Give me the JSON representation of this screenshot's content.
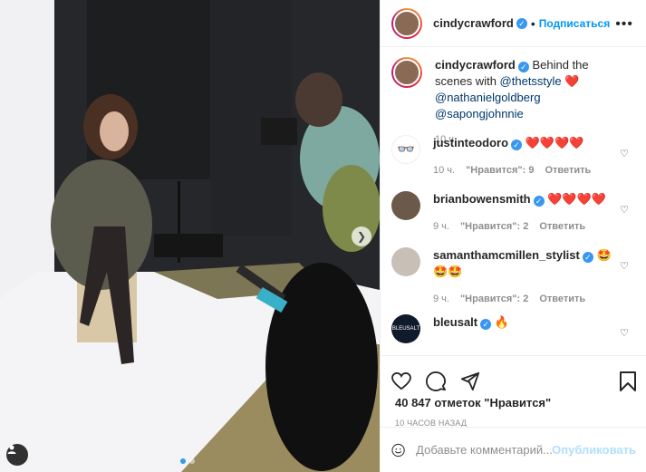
{
  "post": {
    "author": "cindycrawford",
    "follow_label": "Подписаться",
    "separator": "•",
    "more_icon": "more-horizontal-icon"
  },
  "caption": {
    "username": "cindycrawford",
    "text_before": "Behind the scenes with",
    "mention1": "@thetsstyle",
    "emoji": "❤️",
    "mention2": "@nathanielgoldberg",
    "mention3": "@sapongjohnnie",
    "time": "10 ч."
  },
  "comments": [
    {
      "username": "justinteodoro",
      "text": "❤️❤️❤️❤️",
      "time": "10 ч.",
      "likes": "\"Нравится\": 9",
      "reply": "Ответить"
    },
    {
      "username": "brianbowensmith",
      "text": "❤️❤️❤️❤️",
      "time": "9 ч.",
      "likes": "\"Нравится\": 2",
      "reply": "Ответить"
    },
    {
      "username": "samanthamcmillen_stylist",
      "text": "🤩🤩🤩",
      "time": "9 ч.",
      "likes": "\"Нравится\": 2",
      "reply": "Ответить"
    },
    {
      "username": "bleusalt",
      "text": "🔥",
      "time": "",
      "likes": "",
      "reply": ""
    }
  ],
  "engagement": {
    "likes": "40 847 отметок \"Нравится\"",
    "posted": "10 часов назад"
  },
  "composer": {
    "placeholder": "Добавьте комментарий...",
    "publish": "Опубликовать"
  },
  "colors": {
    "accent": "#0095f6",
    "verified": "#3897f0",
    "heart": "#ed4956"
  }
}
